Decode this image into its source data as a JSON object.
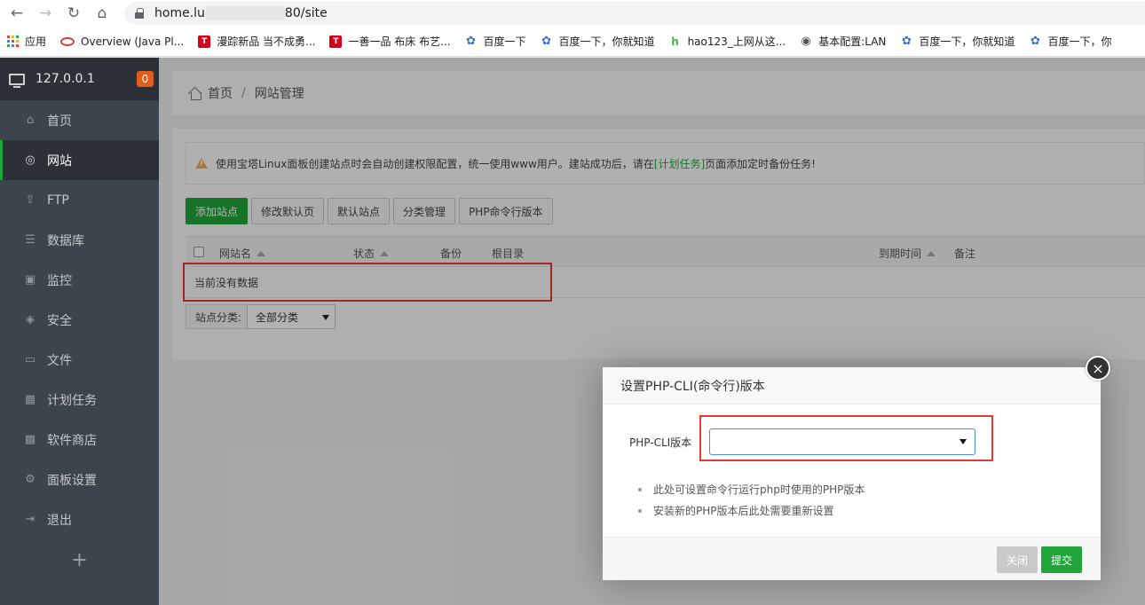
{
  "browser": {
    "back": "←",
    "forward": "→",
    "reload": "↻",
    "home": "⌂",
    "url_start": "home.lu",
    "url_end": "80/site",
    "bookmarks": [
      {
        "label": "应用",
        "icon": "apps-icon"
      },
      {
        "label": "Overview (Java Pl...",
        "icon": "oracle-icon",
        "color": "#c74634",
        "glyph": "O"
      },
      {
        "label": "漫踪新品 当不成勇...",
        "icon": "tmall-icon",
        "color": "#d4001a",
        "glyph": "T"
      },
      {
        "label": "一善一品 布床 布艺...",
        "icon": "tmall-icon",
        "color": "#d4001a",
        "glyph": "T"
      },
      {
        "label": "百度一下",
        "icon": "baidu-paw-icon",
        "color": "#2d72d9",
        "glyph": "✿"
      },
      {
        "label": "百度一下，你就知道",
        "icon": "baidu-paw-icon",
        "color": "#2d72d9",
        "glyph": "✿"
      },
      {
        "label": "hao123_上网从这...",
        "icon": "hao123-icon",
        "color": "#4caf50",
        "glyph": "h"
      },
      {
        "label": "基本配置:LAN",
        "icon": "globe-icon",
        "color": "#555555",
        "glyph": "◉"
      },
      {
        "label": "百度一下，你就知道",
        "icon": "baidu-paw-icon",
        "color": "#2d72d9",
        "glyph": "✿"
      },
      {
        "label": "百度一下，你",
        "icon": "baidu-paw-icon",
        "color": "#2d72d9",
        "glyph": "✿"
      }
    ]
  },
  "sidebar": {
    "host": "127.0.0.1",
    "badge": "0",
    "items": [
      {
        "label": "首页",
        "icon": "home-icon",
        "glyph": "⌂",
        "name": "sidebar-item-home"
      },
      {
        "label": "网站",
        "icon": "globe-icon",
        "glyph": "◎",
        "name": "sidebar-item-site"
      },
      {
        "label": "FTP",
        "icon": "ftp-icon",
        "glyph": "⇪",
        "name": "sidebar-item-ftp"
      },
      {
        "label": "数据库",
        "icon": "database-icon",
        "glyph": "☰",
        "name": "sidebar-item-database"
      },
      {
        "label": "监控",
        "icon": "monitor-chart-icon",
        "glyph": "▣",
        "name": "sidebar-item-monitor"
      },
      {
        "label": "安全",
        "icon": "shield-icon",
        "glyph": "◈",
        "name": "sidebar-item-security"
      },
      {
        "label": "文件",
        "icon": "folder-icon",
        "glyph": "▭",
        "name": "sidebar-item-files"
      },
      {
        "label": "计划任务",
        "icon": "calendar-icon",
        "glyph": "▦",
        "name": "sidebar-item-crontab"
      },
      {
        "label": "软件商店",
        "icon": "grid-icon",
        "glyph": "▩",
        "name": "sidebar-item-store"
      },
      {
        "label": "面板设置",
        "icon": "gear-icon",
        "glyph": "⚙",
        "name": "sidebar-item-settings"
      },
      {
        "label": "退出",
        "icon": "logout-icon",
        "glyph": "⇥",
        "name": "sidebar-item-logout"
      }
    ],
    "active_index": 1,
    "add": "+"
  },
  "breadcrumb": {
    "home": "首页",
    "sep": "/",
    "current": "网站管理"
  },
  "notice": {
    "before": "使用宝塔Linux面板创建站点时会自动创建权限配置，统一使用www用户。建站成功后，请在",
    "link": "[计划任务]",
    "after": "页面添加定时备份任务!"
  },
  "buttons": {
    "add_site": "添加站点",
    "edit_default_page": "修改默认页",
    "default_site": "默认站点",
    "category_manage": "分类管理",
    "php_cli": "PHP命令行版本"
  },
  "table": {
    "columns": {
      "name": "网站名",
      "status": "状态",
      "backup": "备份",
      "root": "根目录",
      "expire": "到期时间",
      "note": "备注"
    },
    "empty": "当前没有数据"
  },
  "category": {
    "label": "站点分类:",
    "value": "全部分类"
  },
  "modal": {
    "title": "设置PHP-CLI(命令行)版本",
    "close": "×",
    "field_label": "PHP-CLI版本",
    "field_value": "",
    "tips": [
      "此处可设置命令行运行php时使用的PHP版本",
      "安装新的PHP版本后此处需要重新设置"
    ],
    "cancel": "关闭",
    "submit": "提交"
  },
  "colors": {
    "accent": "#20a53a",
    "highlight": "#e53935",
    "badge": "#e05d1a"
  }
}
